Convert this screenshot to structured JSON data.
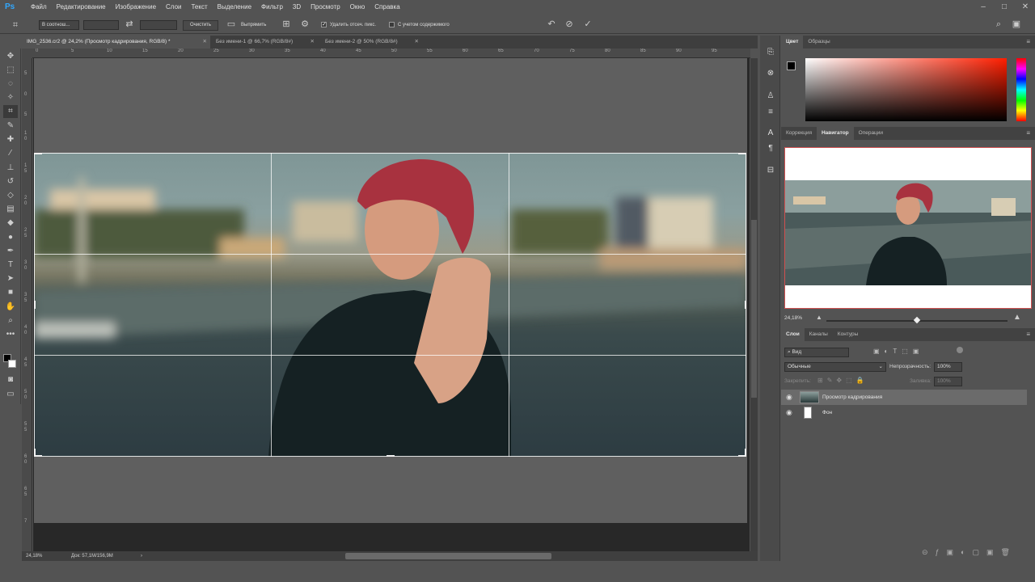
{
  "app": {
    "logo": "Ps"
  },
  "menu": [
    "Файл",
    "Редактирование",
    "Изображение",
    "Слои",
    "Текст",
    "Выделение",
    "Фильтр",
    "3D",
    "Просмотр",
    "Окно",
    "Справка"
  ],
  "options": {
    "ratio_label": "В соотнош...",
    "clear_button": "Очистить",
    "straighten_label": "Выпрямить",
    "delete_cropped_label": "Удалить отсеч. пикс.",
    "delete_cropped_checked": true,
    "content_aware_label": "С учетом содержимого",
    "content_aware_checked": false
  },
  "tabs": [
    {
      "label": "IMG_2536.cr2 @ 24,2% (Просмотр кадрирования, RGB/8) *",
      "active": true
    },
    {
      "label": "Без имени-1 @ 66,7% (RGB/8#)",
      "active": false
    },
    {
      "label": "Без имени-2 @ 50% (RGB/8#)",
      "active": false
    }
  ],
  "ruler_top": [
    "0",
    "5",
    "10",
    "15",
    "20",
    "25",
    "30",
    "35",
    "40",
    "45",
    "50",
    "55",
    "60",
    "65",
    "70",
    "75",
    "80",
    "85",
    "90",
    "95"
  ],
  "ruler_left": [
    "5",
    "0",
    "5",
    "1",
    "0",
    "1",
    "5",
    "2",
    "0",
    "2",
    "5",
    "3",
    "0",
    "3",
    "5",
    "4",
    "0",
    "4",
    "5",
    "5",
    "0",
    "5",
    "5",
    "6",
    "0",
    "6",
    "5",
    "7",
    "0",
    "7",
    "5",
    "8",
    "0",
    "8",
    "5",
    "9",
    "0"
  ],
  "status": {
    "zoom": "24,18%",
    "doc": "Док: 57,1M/156,9M"
  },
  "color_panel": {
    "tabs": [
      "Цвет",
      "Образцы"
    ],
    "foreground": "#000000",
    "background": "#ffffff",
    "accent": "#ff1e00"
  },
  "navigator_panel": {
    "tabs": [
      "Коррекция",
      "Навигатор",
      "Операции"
    ],
    "zoom": "24,18%",
    "zoom_level": 0.5
  },
  "layers_panel": {
    "tabs": [
      "Слои",
      "Каналы",
      "Контуры"
    ],
    "search_placeholder": "Вид",
    "blend_mode": "Обычные",
    "opacity_label": "Непрозрачность:",
    "opacity_value": "100%",
    "lock_label": "Закрепить:",
    "fill_label": "Заливка:",
    "fill_value": "100%",
    "layers": [
      {
        "name": "Просмотр кадрирования",
        "selected": true
      },
      {
        "name": "Фон",
        "selected": false
      }
    ]
  },
  "colors": {
    "panel_bg": "#535353",
    "canvas_bg": "#282828",
    "doc_bg": "#5f5f5f"
  }
}
